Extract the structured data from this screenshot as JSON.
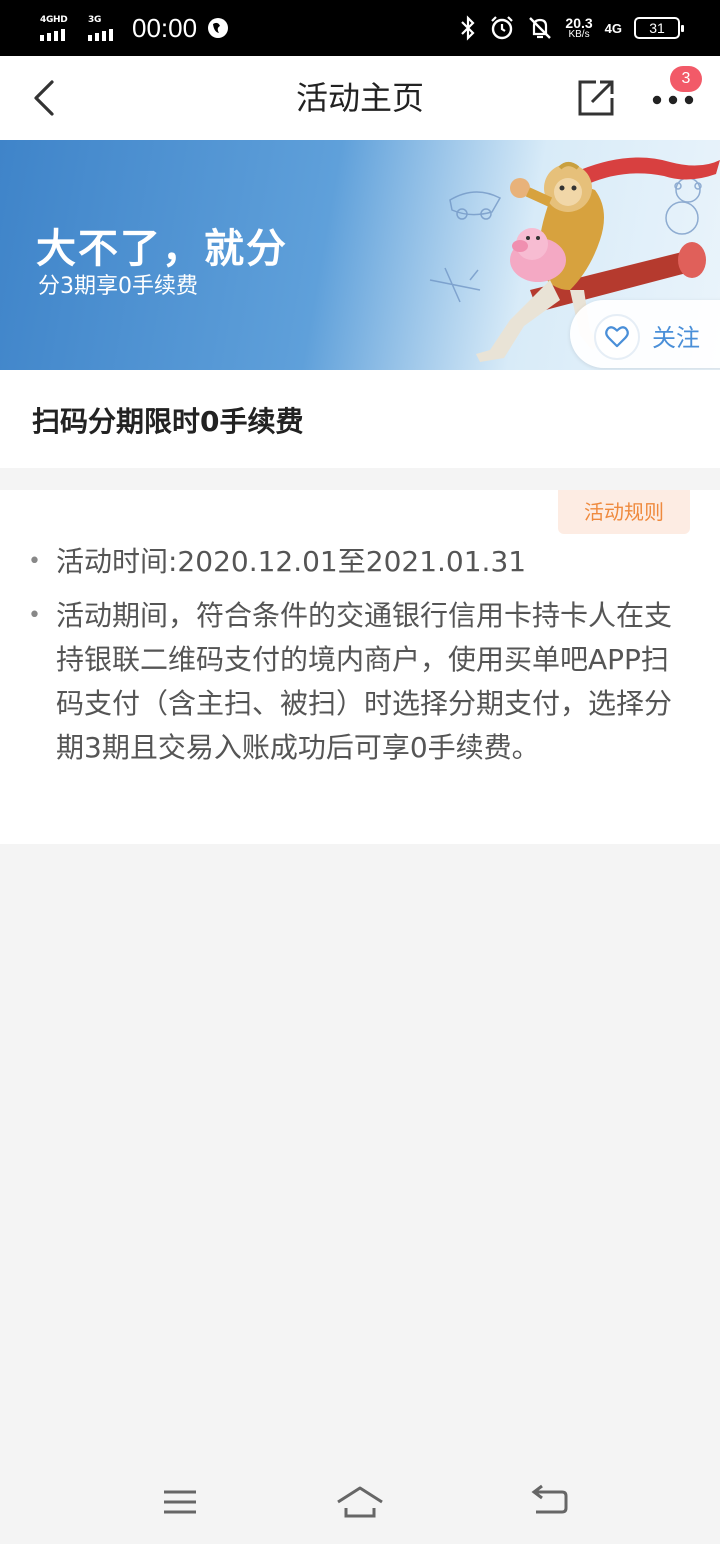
{
  "status_bar": {
    "network1": "4GHD",
    "network2": "3G",
    "time": "00:00",
    "speed_value": "20.3",
    "speed_unit": "KB/s",
    "network_right": "4G",
    "battery": "31",
    "icons": [
      "signal-icon",
      "signal-icon",
      "browser-icon",
      "bluetooth-icon",
      "alarm-icon",
      "mute-icon",
      "battery-icon"
    ]
  },
  "header": {
    "title": "活动主页",
    "badge_count": "3"
  },
  "banner": {
    "title": "大不了，就分",
    "subtitle": "分3期享0手续费",
    "follow_label": "关注"
  },
  "activity": {
    "title": "扫码分期限时0手续费"
  },
  "rules": {
    "tag": "活动规则",
    "items": [
      "活动时间:2020.12.01至2021.01.31",
      "活动期间，符合条件的交通银行信用卡持卡人在支持银联二维码支付的境内商户，使用买单吧APP扫码支付（含主扫、被扫）时选择分期支付，选择分期3期且交易入账成功后可享0手续费。"
    ]
  },
  "colors": {
    "accent_blue": "#4a8fd8",
    "badge_red": "#f25a68",
    "rules_tag_orange": "#ef8a3e"
  }
}
